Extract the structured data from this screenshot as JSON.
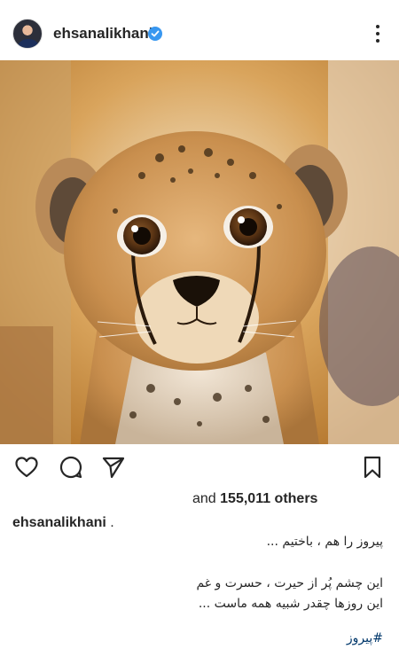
{
  "post": {
    "username": "ehsanalikhani",
    "verified": true
  },
  "likes": {
    "prefix": "and",
    "count_text": "155,011 others"
  },
  "caption": {
    "username": "ehsanalikhani",
    "separator": ".",
    "line1": "پیروز را هم ، باختیم ...",
    "line2": "این چشم پُر از حیرت ، حسرت و غم",
    "line3": "این روزها چقدر شبیه همه ماست ...",
    "hashtag": "#پیروز"
  },
  "icons": [
    "verified-badge-icon",
    "more-options-icon",
    "heart-icon",
    "comment-icon",
    "share-icon",
    "bookmark-icon"
  ],
  "colors": {
    "verified": "#3897f0",
    "hashtag": "#00376b",
    "text": "#262626"
  }
}
